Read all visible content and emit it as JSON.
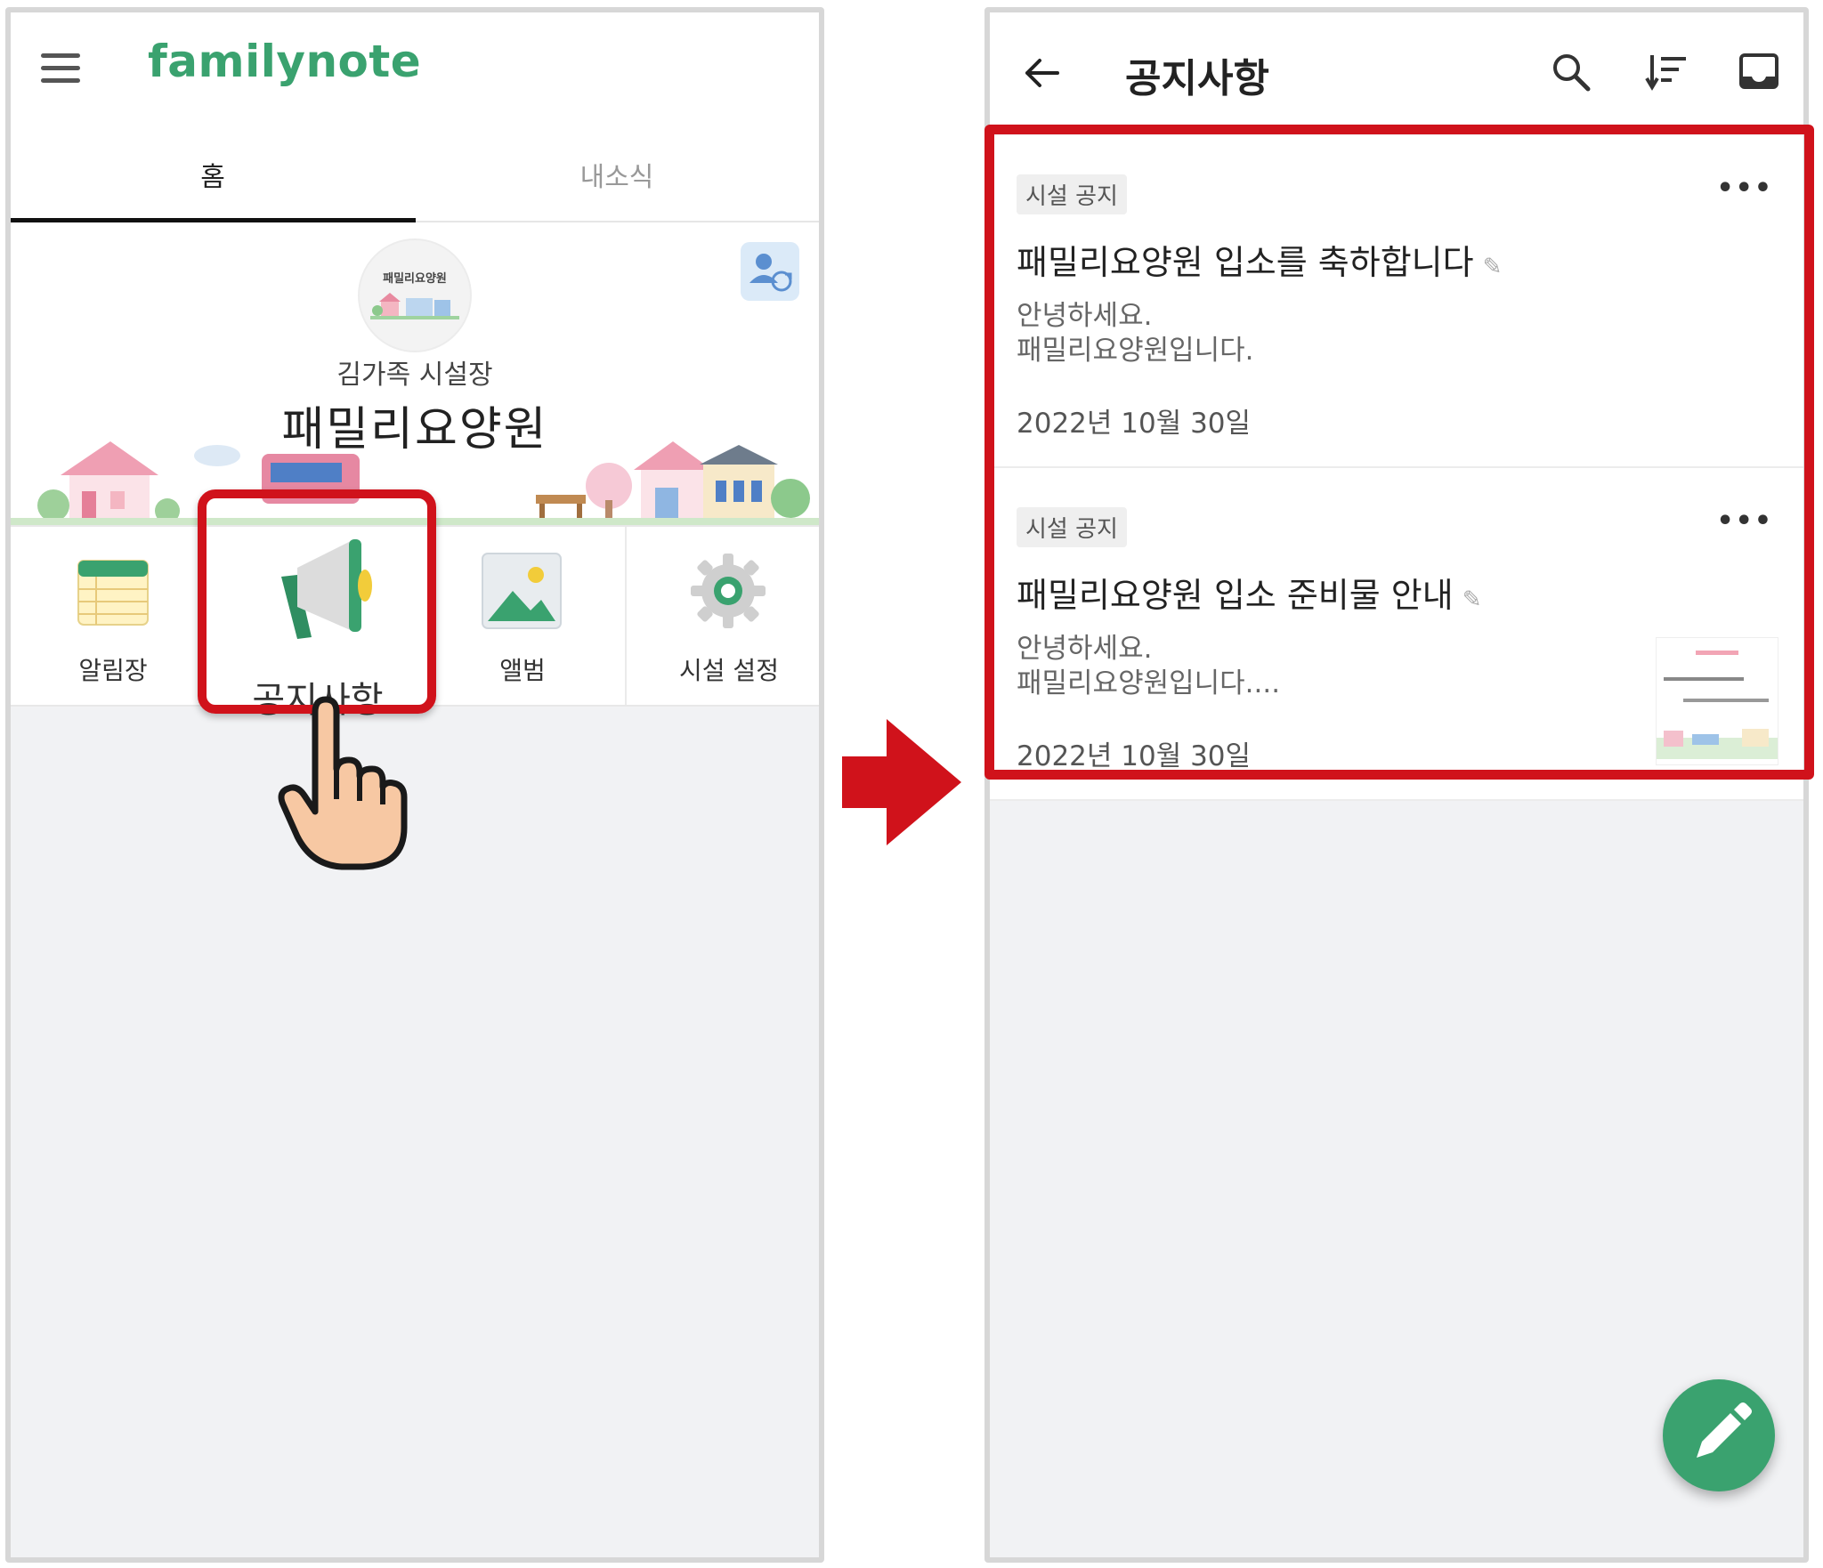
{
  "left_screen": {
    "brand": "familynote",
    "tabs": [
      {
        "label": "홈",
        "active": true
      },
      {
        "label": "내소식",
        "active": false
      }
    ],
    "facility": {
      "logo_text": "패밀리요양원",
      "director": "김가족 시설장",
      "name": "패밀리요양원"
    },
    "menu": [
      {
        "label": "알림장",
        "icon": "calendar-icon"
      },
      {
        "label": "공지사항",
        "icon": "megaphone-icon"
      },
      {
        "label": "앨범",
        "icon": "picture-icon"
      },
      {
        "label": "시설 설정",
        "icon": "gear-icon"
      }
    ]
  },
  "right_screen": {
    "title": "공지사항",
    "icons": [
      "back-arrow-icon",
      "search-icon",
      "sort-icon",
      "inbox-icon",
      "edit-icon"
    ],
    "notices": [
      {
        "category": "시설 공지",
        "title": "패밀리요양원 입소를 축하합니다",
        "body_line1": "안녕하세요.",
        "body_line2": "패밀리요양원입니다.",
        "date": "2022년 10월 30일",
        "has_thumbnail": false
      },
      {
        "category": "시설 공지",
        "title": "패밀리요양원 입소 준비물 안내",
        "body_line1": "안녕하세요.",
        "body_line2": "패밀리요양원입니다....",
        "date": "2022년 10월 30일",
        "has_thumbnail": true
      }
    ]
  },
  "colors": {
    "brand_green": "#3aa26f",
    "highlight_red": "#d0121b"
  }
}
